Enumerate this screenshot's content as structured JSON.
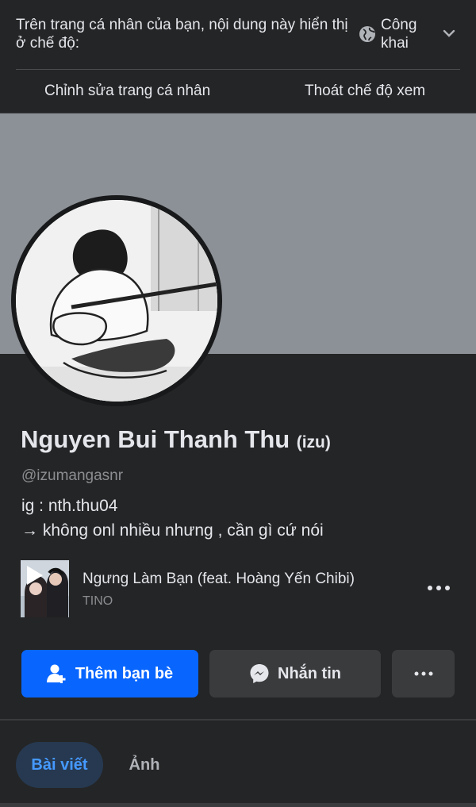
{
  "view_mode": {
    "text": "Trên trang cá nhân của bạn, nội dung này hiển thị ở chế độ:",
    "privacy": "Công khai",
    "icons": {
      "privacy": "globe-icon",
      "expand": "chevron-down-icon"
    }
  },
  "actions": {
    "edit_profile": "Chỉnh sửa trang cá nhân",
    "exit_view": "Thoát chế độ xem"
  },
  "profile": {
    "name": "Nguyen Bui Thanh Thu",
    "nickname": "(izu)",
    "username": "@izumangasnr",
    "bio_line1": "ig : nth.thu04",
    "bio_line2": "→ không onl nhiều nhưng , cần gì cứ nói"
  },
  "music": {
    "title": "Ngưng Làm Bạn (feat. Hoàng Yến Chibi)",
    "artist": "TINO",
    "icons": {
      "play": "play-icon",
      "more": "more-horizontal-icon"
    }
  },
  "buttons": {
    "add_friend": "Thêm bạn bè",
    "message": "Nhắn tin",
    "more": "more-horizontal-icon"
  },
  "tabs": [
    {
      "label": "Bài viết",
      "active": true
    },
    {
      "label": "Ảnh",
      "active": false
    }
  ],
  "colors": {
    "background": "#242526",
    "primary": "#0866ff",
    "secondary_button": "#3a3b3c",
    "active_tab_bg": "#263951",
    "active_tab_text": "#4599ff",
    "cover": "#8c9197"
  }
}
